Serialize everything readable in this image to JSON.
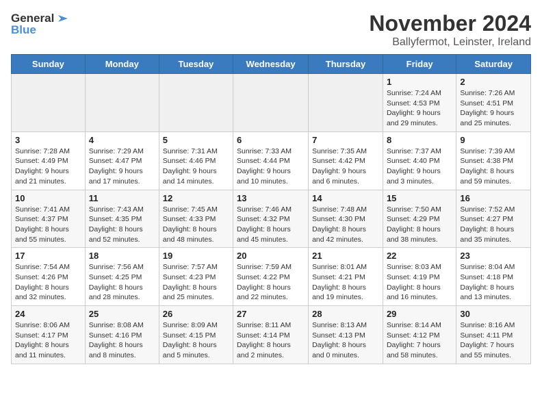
{
  "header": {
    "logo_general": "General",
    "logo_blue": "Blue",
    "month_title": "November 2024",
    "location": "Ballyfermot, Leinster, Ireland"
  },
  "weekdays": [
    "Sunday",
    "Monday",
    "Tuesday",
    "Wednesday",
    "Thursday",
    "Friday",
    "Saturday"
  ],
  "weeks": [
    [
      {
        "day": "",
        "info": ""
      },
      {
        "day": "",
        "info": ""
      },
      {
        "day": "",
        "info": ""
      },
      {
        "day": "",
        "info": ""
      },
      {
        "day": "",
        "info": ""
      },
      {
        "day": "1",
        "info": "Sunrise: 7:24 AM\nSunset: 4:53 PM\nDaylight: 9 hours\nand 29 minutes."
      },
      {
        "day": "2",
        "info": "Sunrise: 7:26 AM\nSunset: 4:51 PM\nDaylight: 9 hours\nand 25 minutes."
      }
    ],
    [
      {
        "day": "3",
        "info": "Sunrise: 7:28 AM\nSunset: 4:49 PM\nDaylight: 9 hours\nand 21 minutes."
      },
      {
        "day": "4",
        "info": "Sunrise: 7:29 AM\nSunset: 4:47 PM\nDaylight: 9 hours\nand 17 minutes."
      },
      {
        "day": "5",
        "info": "Sunrise: 7:31 AM\nSunset: 4:46 PM\nDaylight: 9 hours\nand 14 minutes."
      },
      {
        "day": "6",
        "info": "Sunrise: 7:33 AM\nSunset: 4:44 PM\nDaylight: 9 hours\nand 10 minutes."
      },
      {
        "day": "7",
        "info": "Sunrise: 7:35 AM\nSunset: 4:42 PM\nDaylight: 9 hours\nand 6 minutes."
      },
      {
        "day": "8",
        "info": "Sunrise: 7:37 AM\nSunset: 4:40 PM\nDaylight: 9 hours\nand 3 minutes."
      },
      {
        "day": "9",
        "info": "Sunrise: 7:39 AM\nSunset: 4:38 PM\nDaylight: 8 hours\nand 59 minutes."
      }
    ],
    [
      {
        "day": "10",
        "info": "Sunrise: 7:41 AM\nSunset: 4:37 PM\nDaylight: 8 hours\nand 55 minutes."
      },
      {
        "day": "11",
        "info": "Sunrise: 7:43 AM\nSunset: 4:35 PM\nDaylight: 8 hours\nand 52 minutes."
      },
      {
        "day": "12",
        "info": "Sunrise: 7:45 AM\nSunset: 4:33 PM\nDaylight: 8 hours\nand 48 minutes."
      },
      {
        "day": "13",
        "info": "Sunrise: 7:46 AM\nSunset: 4:32 PM\nDaylight: 8 hours\nand 45 minutes."
      },
      {
        "day": "14",
        "info": "Sunrise: 7:48 AM\nSunset: 4:30 PM\nDaylight: 8 hours\nand 42 minutes."
      },
      {
        "day": "15",
        "info": "Sunrise: 7:50 AM\nSunset: 4:29 PM\nDaylight: 8 hours\nand 38 minutes."
      },
      {
        "day": "16",
        "info": "Sunrise: 7:52 AM\nSunset: 4:27 PM\nDaylight: 8 hours\nand 35 minutes."
      }
    ],
    [
      {
        "day": "17",
        "info": "Sunrise: 7:54 AM\nSunset: 4:26 PM\nDaylight: 8 hours\nand 32 minutes."
      },
      {
        "day": "18",
        "info": "Sunrise: 7:56 AM\nSunset: 4:25 PM\nDaylight: 8 hours\nand 28 minutes."
      },
      {
        "day": "19",
        "info": "Sunrise: 7:57 AM\nSunset: 4:23 PM\nDaylight: 8 hours\nand 25 minutes."
      },
      {
        "day": "20",
        "info": "Sunrise: 7:59 AM\nSunset: 4:22 PM\nDaylight: 8 hours\nand 22 minutes."
      },
      {
        "day": "21",
        "info": "Sunrise: 8:01 AM\nSunset: 4:21 PM\nDaylight: 8 hours\nand 19 minutes."
      },
      {
        "day": "22",
        "info": "Sunrise: 8:03 AM\nSunset: 4:19 PM\nDaylight: 8 hours\nand 16 minutes."
      },
      {
        "day": "23",
        "info": "Sunrise: 8:04 AM\nSunset: 4:18 PM\nDaylight: 8 hours\nand 13 minutes."
      }
    ],
    [
      {
        "day": "24",
        "info": "Sunrise: 8:06 AM\nSunset: 4:17 PM\nDaylight: 8 hours\nand 11 minutes."
      },
      {
        "day": "25",
        "info": "Sunrise: 8:08 AM\nSunset: 4:16 PM\nDaylight: 8 hours\nand 8 minutes."
      },
      {
        "day": "26",
        "info": "Sunrise: 8:09 AM\nSunset: 4:15 PM\nDaylight: 8 hours\nand 5 minutes."
      },
      {
        "day": "27",
        "info": "Sunrise: 8:11 AM\nSunset: 4:14 PM\nDaylight: 8 hours\nand 2 minutes."
      },
      {
        "day": "28",
        "info": "Sunrise: 8:13 AM\nSunset: 4:13 PM\nDaylight: 8 hours\nand 0 minutes."
      },
      {
        "day": "29",
        "info": "Sunrise: 8:14 AM\nSunset: 4:12 PM\nDaylight: 7 hours\nand 58 minutes."
      },
      {
        "day": "30",
        "info": "Sunrise: 8:16 AM\nSunset: 4:11 PM\nDaylight: 7 hours\nand 55 minutes."
      }
    ]
  ]
}
